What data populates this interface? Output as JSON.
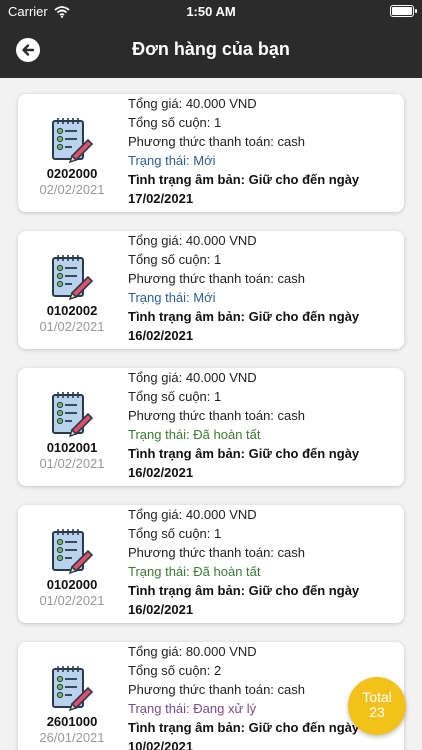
{
  "status_bar": {
    "carrier": "Carrier",
    "time": "1:50 AM"
  },
  "header": {
    "title": "Đơn hàng của bạn"
  },
  "orders": [
    {
      "code": "0202000",
      "date": "02/02/2021",
      "total": "Tổng giá: 40.000 VND",
      "rolls": "Tổng số cuộn: 1",
      "payment": "Phương thức thanh toán: cash",
      "status": "Trạng thái: Mới",
      "status_type": "new",
      "film_line1": "Tình trạng âm bản: Giữ cho đến ngày",
      "film_line2": "17/02/2021"
    },
    {
      "code": "0102002",
      "date": "01/02/2021",
      "total": "Tổng giá: 40.000 VND",
      "rolls": "Tổng số cuộn: 1",
      "payment": "Phương thức thanh toán: cash",
      "status": "Trạng thái: Mới",
      "status_type": "new",
      "film_line1": "Tình trạng âm bản: Giữ cho đến ngày",
      "film_line2": "16/02/2021"
    },
    {
      "code": "0102001",
      "date": "01/02/2021",
      "total": "Tổng giá: 40.000 VND",
      "rolls": "Tổng số cuộn: 1",
      "payment": "Phương thức thanh toán: cash",
      "status": "Trạng thái: Đã hoàn tất",
      "status_type": "done",
      "film_line1": "Tình trạng âm bản: Giữ cho đến ngày",
      "film_line2": "16/02/2021"
    },
    {
      "code": "0102000",
      "date": "01/02/2021",
      "total": "Tổng giá: 40.000 VND",
      "rolls": "Tổng số cuộn: 1",
      "payment": "Phương thức thanh toán: cash",
      "status": "Trạng thái: Đã hoàn tất",
      "status_type": "done",
      "film_line1": "Tình trạng âm bản: Giữ cho đến ngày",
      "film_line2": "16/02/2021"
    },
    {
      "code": "2601000",
      "date": "26/01/2021",
      "total": "Tổng giá: 80.000 VND",
      "rolls": "Tổng số cuộn: 2",
      "payment": "Phương thức thanh toán: cash",
      "status": "Trạng thái: Đang xử lý",
      "status_type": "processing",
      "film_line1": "Tình trạng âm bản: Giữ cho đến ngày",
      "film_line2": "10/02/2021"
    }
  ],
  "fab": {
    "label": "Total",
    "count": "23"
  },
  "colors": {
    "header_bg": "#2b2b2b",
    "fab": "#f2c21b",
    "status_new": "#2d5f8f",
    "status_done": "#3a7d32",
    "status_processing": "#7a4a8f"
  },
  "icons": {
    "back": "arrow-left-circle-icon",
    "order": "checklist-notepad-icon",
    "wifi": "wifi-icon",
    "battery": "battery-icon"
  }
}
